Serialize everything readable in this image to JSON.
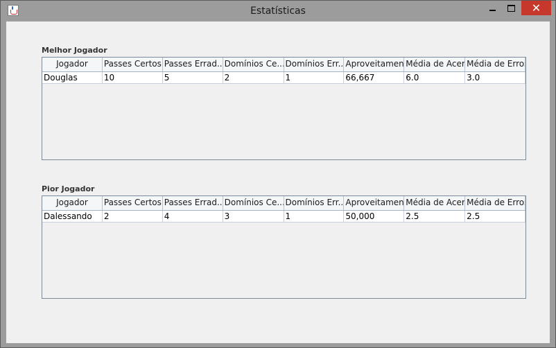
{
  "window": {
    "title": "Estatísticas",
    "close_symbol": "✕"
  },
  "best": {
    "label": "Melhor Jogador",
    "columns": [
      "Jogador",
      "Passes Certos",
      "Passes Errad...",
      "Domínios Ce...",
      "Domínios Err...",
      "Aproveitamento",
      "Média de Acer...",
      "Média de Erros"
    ],
    "row": [
      "Douglas",
      "10",
      "5",
      "2",
      "1",
      "66,667",
      "6.0",
      "3.0"
    ]
  },
  "worst": {
    "label": "Pior Jogador",
    "columns": [
      "Jogador",
      "Passes Certos",
      "Passes Errad...",
      "Domínios Ce...",
      "Domínios Err...",
      "Aproveitamento",
      "Média de Acer...",
      "Média de Erros"
    ],
    "row": [
      "Dalessando",
      "2",
      "4",
      "3",
      "1",
      "50,000",
      "2.5",
      "2.5"
    ]
  }
}
